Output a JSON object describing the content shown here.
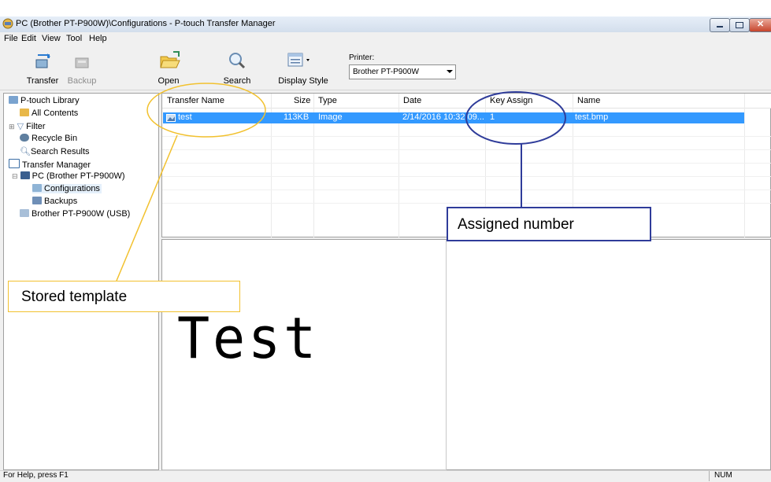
{
  "window": {
    "title": "PC (Brother PT-P900W)\\Configurations - P-touch Transfer Manager"
  },
  "menu": [
    "File",
    "Edit",
    "View",
    "Tool",
    "Help"
  ],
  "toolbar": {
    "transfer": "Transfer",
    "backup": "Backup",
    "open": "Open",
    "search": "Search",
    "display_style": "Display Style",
    "printer_label": "Printer:",
    "printer_value": "Brother PT-P900W"
  },
  "tree": {
    "library": "P-touch Library",
    "all_contents": "All Contents",
    "filter": "Filter",
    "recycle_bin": "Recycle Bin",
    "search_results": "Search Results",
    "transfer_manager": "Transfer Manager",
    "pc": "PC (Brother PT-P900W)",
    "configurations": "Configurations",
    "backups": "Backups",
    "usb_printer": "Brother PT-P900W (USB)"
  },
  "list": {
    "columns": [
      "Transfer Name",
      "Size",
      "Type",
      "Date",
      "Key Assign",
      "Name"
    ],
    "rows": [
      {
        "transfer_name": "test",
        "size": "113KB",
        "type": "Image",
        "date": "2/14/2016 10:32:09...",
        "key_assign": "1",
        "name": "test.bmp"
      }
    ]
  },
  "preview": {
    "text": "Test"
  },
  "status": {
    "help": "For Help, press F1",
    "num": "NUM"
  },
  "annotations": {
    "stored_template": "Stored template",
    "assigned_number": "Assigned number"
  },
  "colors": {
    "selection": "#3399ff",
    "callout_yellow": "#f2c12e",
    "callout_blue": "#2f3c9a"
  }
}
